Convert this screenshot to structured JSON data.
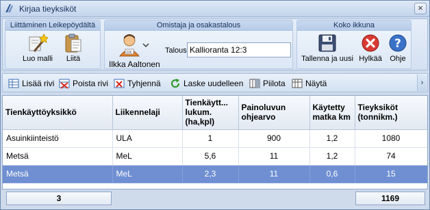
{
  "window": {
    "title": "Kirjaa tieyksiköt"
  },
  "ribbon": {
    "clipboard": {
      "title": "Liittäminen Leikepöydältä",
      "template_label": "Luo malli",
      "paste_label": "Liitä"
    },
    "owner": {
      "title": "Omistaja ja osakastalous",
      "owner_name": "Ilkka Aaltonen",
      "household_label": "Talous",
      "household_value": "Kallioranta 12:3"
    },
    "window_group": {
      "title": "Koko ikkuna",
      "save_new_label": "Tallenna ja uusi",
      "reject_label": "Hylkää",
      "help_label": "Ohje"
    }
  },
  "toolbar": {
    "add_row": "Lisää rivi",
    "delete_row": "Poista rivi",
    "clear": "Tyhjennä",
    "recalculate": "Laske uudelleen",
    "hide": "Piilota",
    "show": "Näytä"
  },
  "grid": {
    "headers": [
      "Tienkäyttöyksikkö",
      "Liikennelaji",
      "Tienkäytt... lukum. (ha,kpl)",
      "Painoluvun ohjearvo",
      "Käytetty matka km",
      "Tieyksiköt (tonnikm.)"
    ],
    "rows": [
      [
        "Asuinkiinteistö",
        "ULA",
        "1",
        "900",
        "1,2",
        "1080"
      ],
      [
        "Metsä",
        "MeL",
        "5,6",
        "11",
        "1,2",
        "74"
      ],
      [
        "Metsä",
        "MeL",
        "2,3",
        "11",
        "0,6",
        "15"
      ]
    ],
    "selected_row": 2
  },
  "footer": {
    "row_count": "3",
    "total_units": "1169"
  },
  "colors": {
    "selection": "#6f8fd2",
    "reject_red": "#d93a32",
    "help_blue": "#3a72c8"
  }
}
